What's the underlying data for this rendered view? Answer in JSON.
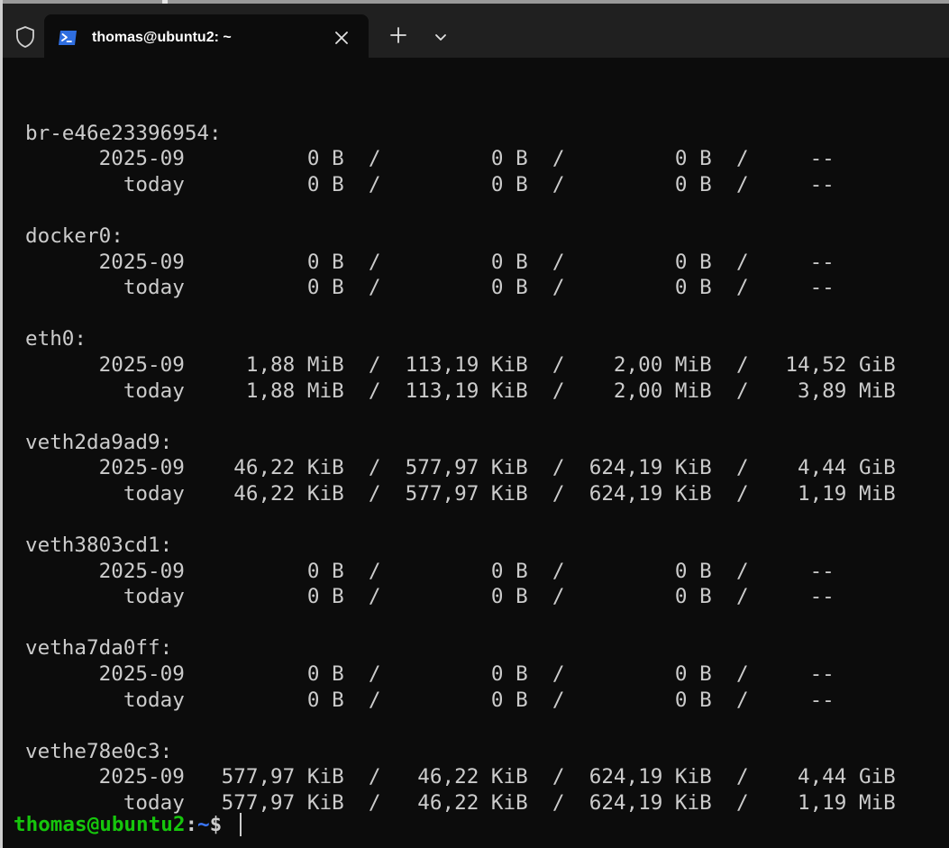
{
  "window": {
    "tab_title": "thomas@ubuntu2: ~",
    "tab_icon": "powershell-icon",
    "accent": "#3b78ff"
  },
  "terminal": {
    "lines": [
      "",
      "br-e46e23396954:",
      "      2025-09          0 B  /         0 B  /         0 B  /     --",
      "        today          0 B  /         0 B  /         0 B  /     --",
      "",
      "docker0:",
      "      2025-09          0 B  /         0 B  /         0 B  /     --",
      "        today          0 B  /         0 B  /         0 B  /     --",
      "",
      "eth0:",
      "      2025-09     1,88 MiB  /  113,19 KiB  /    2,00 MiB  /   14,52 GiB",
      "        today     1,88 MiB  /  113,19 KiB  /    2,00 MiB  /    3,89 MiB",
      "",
      "veth2da9ad9:",
      "      2025-09    46,22 KiB  /  577,97 KiB  /  624,19 KiB  /    4,44 GiB",
      "        today    46,22 KiB  /  577,97 KiB  /  624,19 KiB  /    1,19 MiB",
      "",
      "veth3803cd1:",
      "      2025-09          0 B  /         0 B  /         0 B  /     --",
      "        today          0 B  /         0 B  /         0 B  /     --",
      "",
      "vetha7da0ff:",
      "      2025-09          0 B  /         0 B  /         0 B  /     --",
      "        today          0 B  /         0 B  /         0 B  /     --",
      "",
      "vethe78e0c3:",
      "      2025-09   577,97 KiB  /   46,22 KiB  /  624,19 KiB  /    4,44 GiB",
      "        today   577,97 KiB  /   46,22 KiB  /  624,19 KiB  /    1,19 MiB"
    ],
    "prompt": {
      "user_host": "thomas@ubuntu2",
      "colon": ":",
      "path": "~",
      "sign": "$ "
    }
  }
}
